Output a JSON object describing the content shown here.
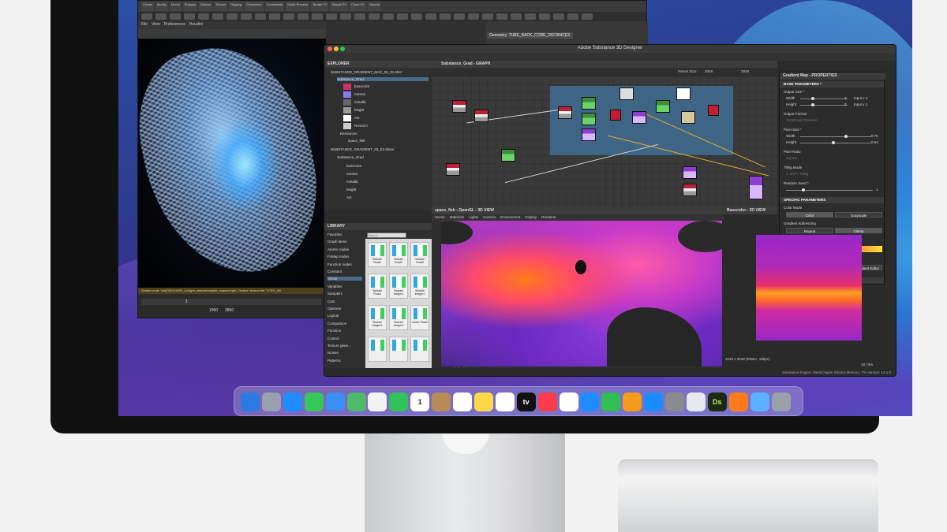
{
  "houdini": {
    "shelf_tabs": [
      "Create",
      "Modify",
      "Model",
      "Polygon",
      "Deform",
      "Texture",
      "Rigging",
      "Characters",
      "Constraints",
      "Guide Process",
      "Terrain FX",
      "Simple FX",
      "Cloud FX",
      "Volume"
    ],
    "menu": [
      "File",
      "View",
      "Preferences",
      "Houdini"
    ],
    "geometry_tab": "Geometry: TUBE_BACK_CORE_DISTANCES",
    "status_text": "Shader node '/obj/GEO/HDRI_A1/light_shader/redshift_vopnet/Light_Texture' texture file 'T:/TEX_Wi",
    "frame_start": "1",
    "frame_current": "1900",
    "frame_end": "2800"
  },
  "sd": {
    "window_title": "Adobe Substance 3D Designer",
    "explorer": {
      "header": "EXPLORER",
      "package1": "SUBSTANCE_GRADIENT_MAC_03_02.sbs*",
      "graph1": "Substance_Grad",
      "outputs": [
        "basecolor",
        "normal",
        "metallic",
        "height",
        "AO",
        "ROUGH"
      ],
      "resources": "Resources",
      "resource_item": "space_fish",
      "package2": "SUBSTANCE_GRADIENT_03_02.sbsar",
      "graph2": "Substance_Grad",
      "outputs2": [
        "basecolor",
        "normal",
        "metallic",
        "height",
        "AO"
      ]
    },
    "library": {
      "header": "LIBRARY",
      "search_placeholder": "Search",
      "categories": [
        "Favorites",
        "Graph items",
        "Atomic nodes",
        "FxMap nodes",
        "Function nodes",
        "Constant",
        "Vector",
        "Variables",
        "Samplers",
        "Cast",
        "Operator",
        "Logical",
        "Comparison",
        "Function",
        "Control",
        "Texture gene...",
        "Noises",
        "Patterns"
      ],
      "nodes": [
        "Swizzle Float1",
        "Swizzle Float2",
        "Swizzle Float3",
        "Swizzle Float4",
        "Swizzle Integer1",
        "Swizzle Integer2",
        "Swizzle Integer3",
        "Swizzle Integer4",
        "Vector Float2",
        "",
        "",
        ""
      ]
    },
    "graph": {
      "header": "Substance_Grad - GRAPH",
      "parent_size_label": "Parent Size:",
      "parent_size": "2048",
      "size2": "2048"
    },
    "view3d": {
      "header": "space_fish - OpenGL - 3D VIEW",
      "menu": [
        "Scene",
        "Materials",
        "Lights",
        "Camera",
        "Environment",
        "Display",
        "Renderer"
      ],
      "colorspace": "sRGB (default)"
    },
    "view2d": {
      "header": "Basecolor - 2D VIEW",
      "info": "2048 x 2048 (RGBA, 16bpc)",
      "zoom": "18.74%"
    },
    "properties": {
      "header": "Gradient Map - PROPERTIES",
      "base_params": "BASE PARAMETERS *",
      "output_size": "Output Size *",
      "width_label": "Width",
      "width_val": "2",
      "width_input": "Input x 4",
      "height_label": "Height",
      "height_val": "0",
      "height_input": "Input x 1",
      "output_format": "Output Format",
      "output_format_val": "16 Bits per Channel",
      "pixel_size": "Pixel Size *",
      "px_width": "0.76",
      "px_height": "0.64",
      "pixel_ratio": "Pixel Ratio",
      "pixel_ratio_val": "Square",
      "tiling_mode": "Tiling Mode",
      "tiling_val": "H and V Tiling",
      "random_seed": "Random Seed *",
      "random_val": "1",
      "specific_params": "SPECIFIC PARAMETERS",
      "color_mode": "Color Mode",
      "color_btn": "Color",
      "gray_btn": "Grayscale",
      "addressing": "Gradient Addressing",
      "repeat_btn": "Repeat",
      "clamp_btn": "Clamp",
      "gradient": "Gradient",
      "gradient_editor": "Gradient Editor",
      "input_values": "INPUT VALUES"
    },
    "status": "Substance Engine: Metal (Apple Silicon)  Memory: 7%    Version: 14.1.0"
  },
  "dock": {
    "apps": [
      {
        "name": "finder-icon",
        "color": "#2c7be5"
      },
      {
        "name": "launchpad-icon",
        "color": "#9aa0b0"
      },
      {
        "name": "safari-icon",
        "color": "#1f8cff"
      },
      {
        "name": "messages-icon",
        "color": "#35c759"
      },
      {
        "name": "mail-icon",
        "color": "#3a8ff5"
      },
      {
        "name": "maps-icon",
        "color": "#4fb86a"
      },
      {
        "name": "photos-icon",
        "color": "#f2f2f2"
      },
      {
        "name": "facetime-icon",
        "color": "#2fc35a"
      },
      {
        "name": "calendar-icon",
        "color": "#ffffff"
      },
      {
        "name": "contacts-icon",
        "color": "#b88a55"
      },
      {
        "name": "reminders-icon",
        "color": "#ffffff"
      },
      {
        "name": "notes-icon",
        "color": "#ffd84a"
      },
      {
        "name": "freeform-icon",
        "color": "#ffffff"
      },
      {
        "name": "tv-icon",
        "color": "#111111"
      },
      {
        "name": "music-icon",
        "color": "#fa3c4c"
      },
      {
        "name": "news-icon",
        "color": "#ffffff"
      },
      {
        "name": "keynote-icon",
        "color": "#1f8cff"
      },
      {
        "name": "numbers-icon",
        "color": "#2fbf52"
      },
      {
        "name": "pages-icon",
        "color": "#f59a1a"
      },
      {
        "name": "app-store-icon",
        "color": "#1a8cff"
      },
      {
        "name": "system-settings-icon",
        "color": "#8a8a90"
      },
      {
        "name": "xcode-instruments-icon",
        "color": "#e8e8ee"
      },
      {
        "name": "substance-designer-icon",
        "color": "#1c2a12"
      },
      {
        "name": "houdini-icon",
        "color": "#ff7a1a"
      },
      {
        "name": "downloads-folder-icon",
        "color": "#5ab0ff"
      },
      {
        "name": "trash-icon",
        "color": "#9aa0a8"
      }
    ],
    "labels": {
      "tv": "tv",
      "calendar_day": "1",
      "ds": "Ds"
    }
  }
}
